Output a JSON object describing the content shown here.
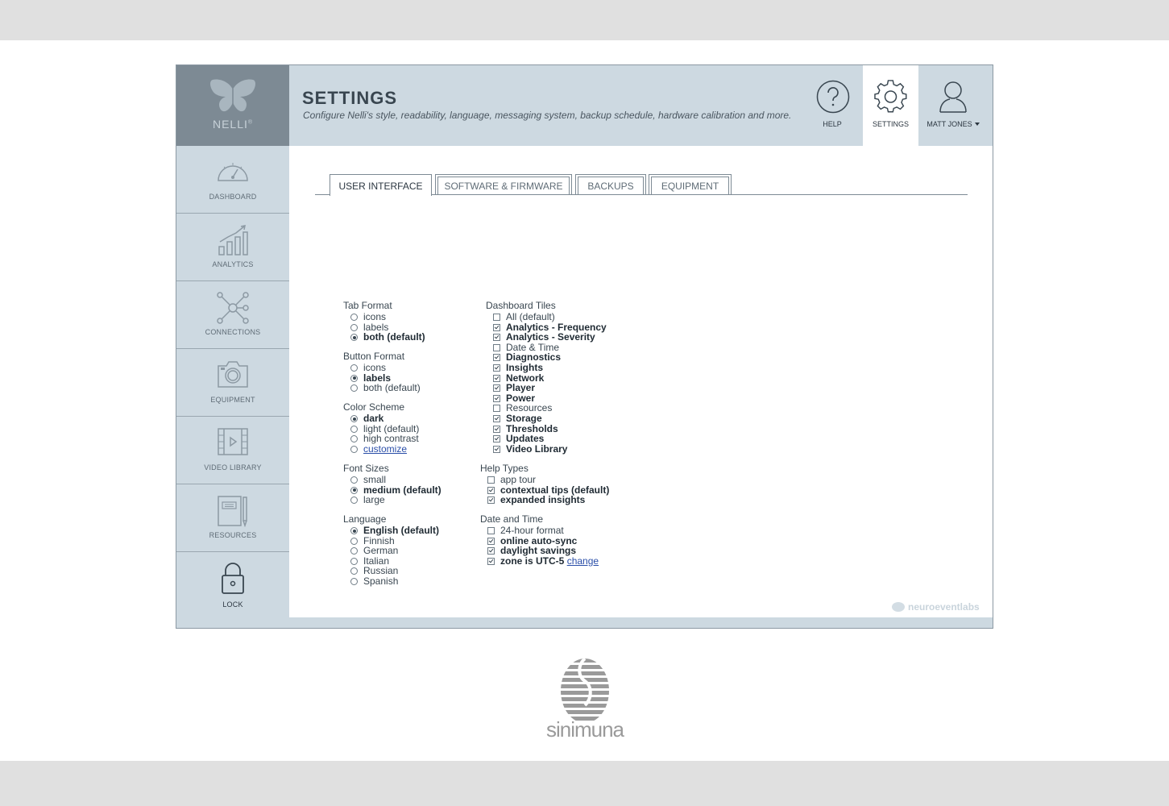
{
  "app": {
    "logo_text": "NELLI",
    "logo_mark": "®",
    "brand_color": "#cdd9e1",
    "sidebar_dark": "#7d8a94"
  },
  "sidebar": {
    "items": [
      {
        "label": "DASHBOARD",
        "icon": "speedometer-icon"
      },
      {
        "label": "ANALYTICS",
        "icon": "bar-chart-icon"
      },
      {
        "label": "CONNECTIONS",
        "icon": "network-icon"
      },
      {
        "label": "EQUIPMENT",
        "icon": "camera-icon"
      },
      {
        "label": "VIDEO LIBRARY",
        "icon": "film-icon"
      },
      {
        "label": "RESOURCES",
        "icon": "notebook-icon"
      },
      {
        "label": "LOCK",
        "icon": "lock-icon"
      }
    ]
  },
  "header": {
    "title": "SETTINGS",
    "subtitle": "Configure Nelli's style, readability, language, messaging system, backup schedule, hardware calibration and more.",
    "help_label": "HELP",
    "settings_label": "SETTINGS",
    "user_label": "MATT JONES"
  },
  "tabs": [
    {
      "label": "USER INTERFACE",
      "active": true
    },
    {
      "label": "SOFTWARE & FIRMWARE",
      "active": false
    },
    {
      "label": "BACKUPS",
      "active": false
    },
    {
      "label": "EQUIPMENT",
      "active": false
    }
  ],
  "settings": {
    "tab_format": {
      "title": "Tab Format",
      "options": [
        "icons",
        "labels",
        "both (default)"
      ],
      "selected": 2
    },
    "button_format": {
      "title": "Button Format",
      "options": [
        "icons",
        "labels",
        "both (default)"
      ],
      "selected": 1
    },
    "color_scheme": {
      "title": "Color Scheme",
      "options": [
        "dark",
        "light (default)",
        "high contrast",
        "customize"
      ],
      "selected": 0
    },
    "font_sizes": {
      "title": "Font Sizes",
      "options": [
        "small",
        "medium (default)",
        "large"
      ],
      "selected": 1
    },
    "language": {
      "title": "Language",
      "options": [
        "English (default)",
        "Finnish",
        "German",
        "Italian",
        "Russian",
        "Spanish"
      ],
      "selected": 0
    },
    "dashboard_tiles": {
      "title": "Dashboard Tiles",
      "items": [
        {
          "label": "All (default)",
          "checked": false
        },
        {
          "label": "Analytics - Frequency",
          "checked": true
        },
        {
          "label": "Analytics - Severity",
          "checked": true
        },
        {
          "label": "Date & Time",
          "checked": false
        },
        {
          "label": "Diagnostics",
          "checked": true
        },
        {
          "label": "Insights",
          "checked": true
        },
        {
          "label": "Network",
          "checked": true
        },
        {
          "label": "Player",
          "checked": true
        },
        {
          "label": "Power",
          "checked": true
        },
        {
          "label": "Resources",
          "checked": false
        },
        {
          "label": "Storage",
          "checked": true
        },
        {
          "label": "Thresholds",
          "checked": true
        },
        {
          "label": "Updates",
          "checked": true
        },
        {
          "label": "Video Library",
          "checked": true
        }
      ]
    },
    "help_types": {
      "title": "Help Types",
      "items": [
        {
          "label": "app tour",
          "checked": false
        },
        {
          "label": "contextual tips (default)",
          "checked": true
        },
        {
          "label": "expanded insights",
          "checked": true
        }
      ]
    },
    "date_time": {
      "title": "Date and Time",
      "items": [
        {
          "label": "24-hour format",
          "checked": false
        },
        {
          "label": "online auto-sync",
          "checked": true
        },
        {
          "label": "daylight savings",
          "checked": true
        },
        {
          "label": "zone is UTC-5",
          "checked": true
        }
      ],
      "change_link": "change"
    }
  },
  "footer": {
    "partner": "neuroeventlabs",
    "company": "sinimuna"
  }
}
